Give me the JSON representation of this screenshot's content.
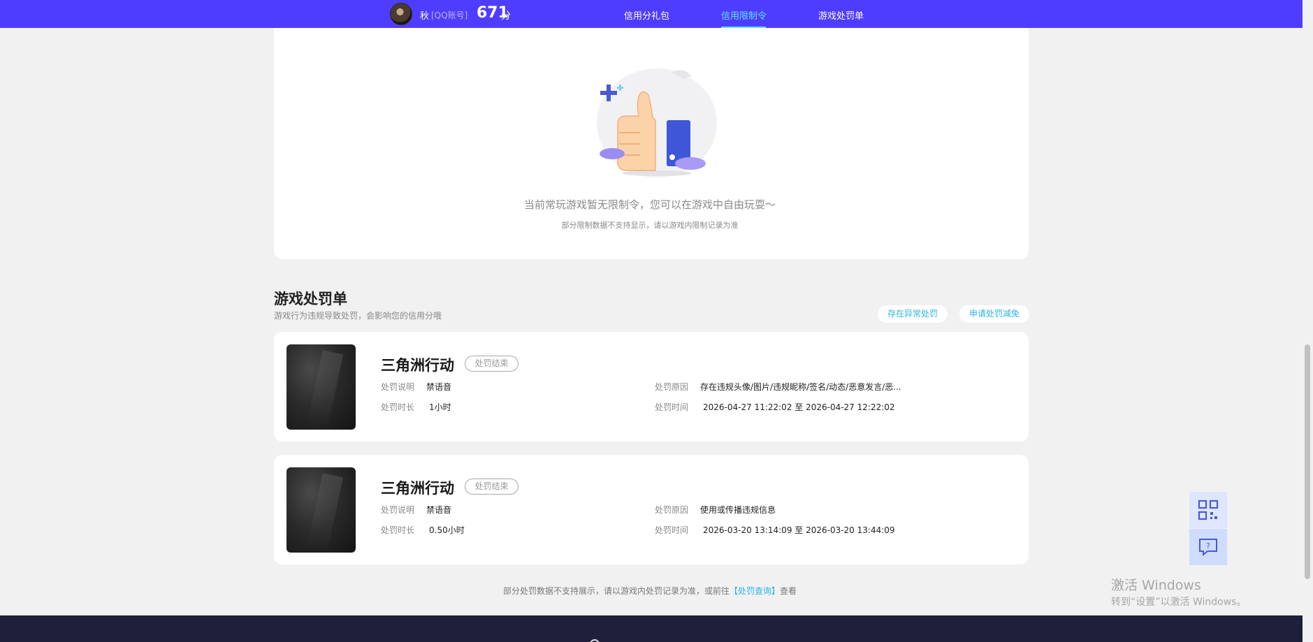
{
  "header": {
    "user_name": "秋",
    "account_type": "[QQ账号]",
    "credit_score": "671",
    "score_unit": "分",
    "tabs": [
      {
        "label": "信用分礼包",
        "active": false
      },
      {
        "label": "信用限制令",
        "active": true
      },
      {
        "label": "游戏处罚单",
        "active": false
      }
    ],
    "accent_color": "#4f3dff",
    "active_color": "#5ee3ff"
  },
  "restriction": {
    "empty_message": "当前常玩游戏暂无限制令，您可以在游戏中自由玩耍～",
    "sub_message": "部分限制数据不支持显示，请以游戏内限制记录为准",
    "illustration_icon": "thumbs-up-illustration"
  },
  "punishment": {
    "title": "游戏处罚单",
    "description": "游戏行为违规导致处罚，会影响您的信用分哦",
    "action_abnormal": "存在异常处罚",
    "action_appeal": "申请处罚减免",
    "labels": {
      "explain": "处罚说明",
      "duration": "处罚时长",
      "reason": "处罚原因",
      "time": "处罚时间"
    },
    "items": [
      {
        "game": "三角洲行动",
        "status": "处罚结束",
        "explain": "禁语音",
        "duration": "1小时",
        "reason": "存在违规头像/图片/违规昵称/签名/动态/恶意发言/恶...",
        "time": "2026-04-27 11:22:02 至 2026-04-27 12:22:02"
      },
      {
        "game": "三角洲行动",
        "status": "处罚结束",
        "explain": "禁语音",
        "duration": "0.50小时",
        "reason": "使用或传播违规信息",
        "time": "2026-03-20 13:14:09 至 2026-03-20 13:44:09"
      }
    ],
    "footnote_before": "部分处罚数据不支持展示，请以游戏内处罚记录为准，或前往",
    "footnote_link": "【处罚查询】",
    "footnote_after": "查看"
  },
  "float_buttons": {
    "qr_icon": "qrcode-icon",
    "feedback_icon": "feedback-question-icon"
  },
  "watermark": {
    "title": "激活 Windows",
    "subtitle": "转到“设置”以激活 Windows。"
  }
}
